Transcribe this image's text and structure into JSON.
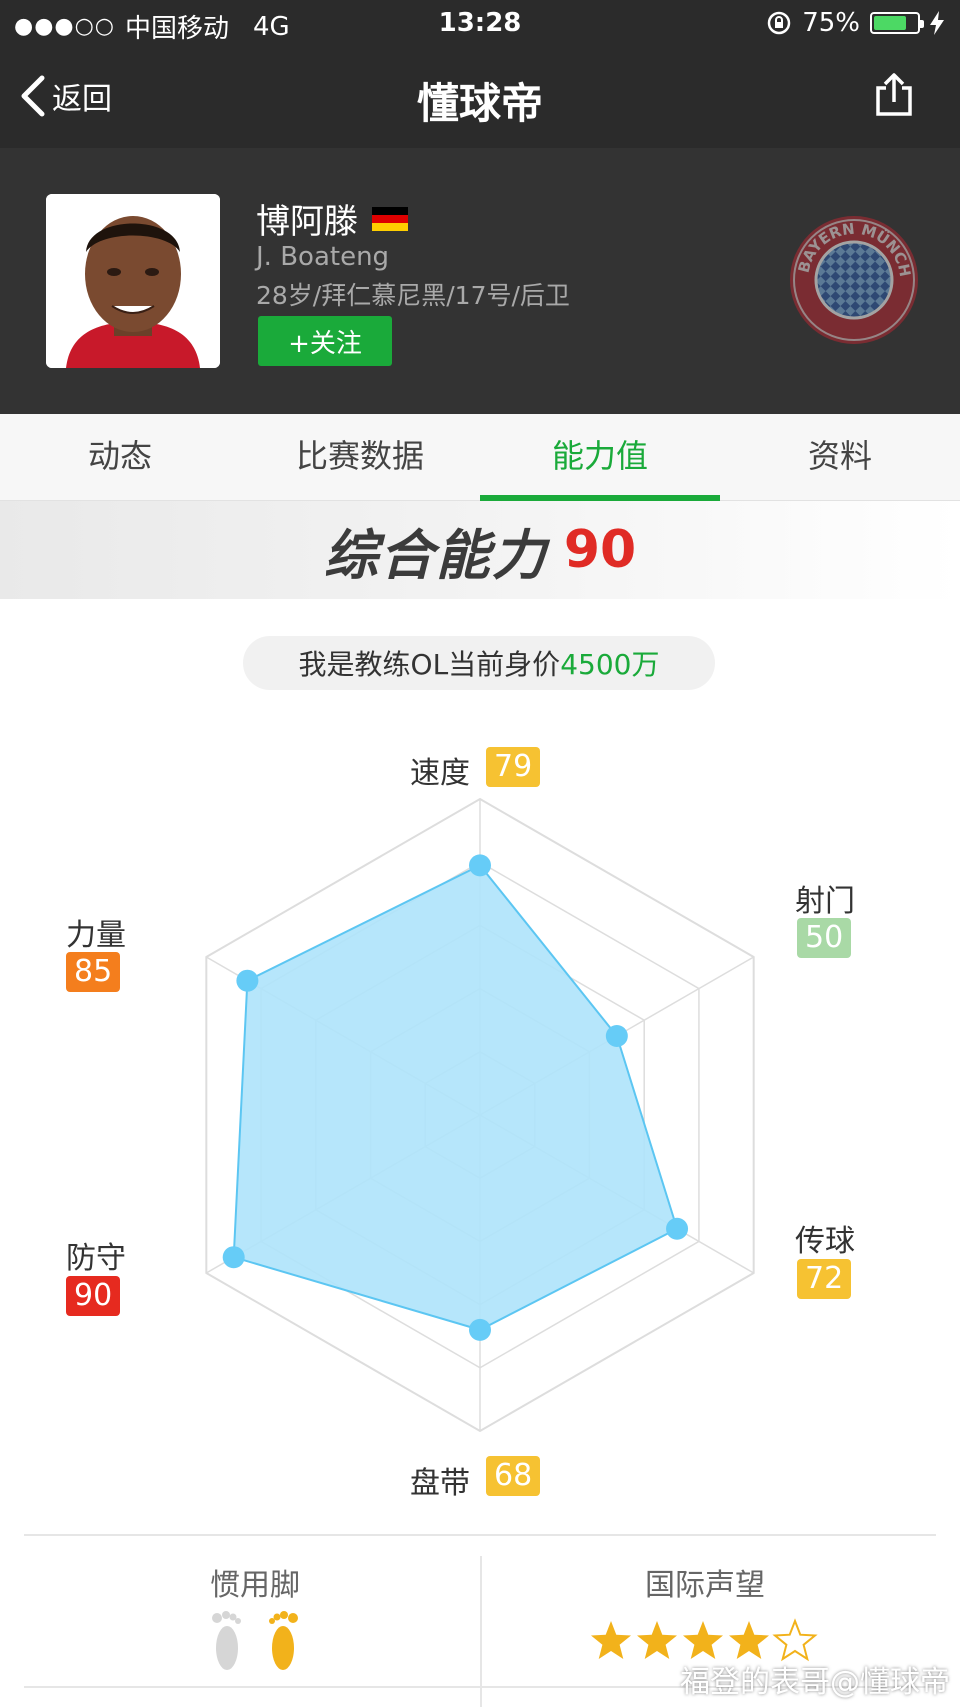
{
  "status_bar": {
    "signal": "●●●○○",
    "carrier": "中国移动",
    "network": "4G",
    "time": "13:28",
    "battery": "75%",
    "battery_level": 0.75
  },
  "nav": {
    "back_label": "返回",
    "title": "懂球帝"
  },
  "player": {
    "name_cn": "博阿滕",
    "name_en": "J. Boateng",
    "info": "28岁/拜仁慕尼黑/17号/后卫",
    "follow_label": "+关注",
    "club_logo_text": "FC BAYERN MÜNCHEN"
  },
  "tabs": [
    {
      "label": "动态"
    },
    {
      "label": "比赛数据"
    },
    {
      "label": "能力值",
      "active": true
    },
    {
      "label": "资料"
    }
  ],
  "overall": {
    "label": "综合能力",
    "value": "90"
  },
  "market_value": {
    "prefix": "我是教练OL当前身价",
    "amount": "4500万"
  },
  "chart_data": {
    "type": "radar",
    "max": 100,
    "axes": [
      {
        "label": "速度",
        "value": 79,
        "color": "#f6c232"
      },
      {
        "label": "射门",
        "value": 50,
        "color": "#a9d9a6"
      },
      {
        "label": "传球",
        "value": 72,
        "color": "#f6c232"
      },
      {
        "label": "盘带",
        "value": 68,
        "color": "#f6c232"
      },
      {
        "label": "防守",
        "value": 90,
        "color": "#e62a1f"
      },
      {
        "label": "力量",
        "value": 85,
        "color": "#f47e1d"
      }
    ],
    "fill_color": "#aee3fb",
    "line_color": "#5cc6f2",
    "point_color": "#66ccf7",
    "grid": true
  },
  "bottom": {
    "foot_title": "惯用脚",
    "reputation_title": "国际声望",
    "reputation_stars": 4,
    "reputation_max": 5
  },
  "watermark": "福登的表哥@懂球帝"
}
